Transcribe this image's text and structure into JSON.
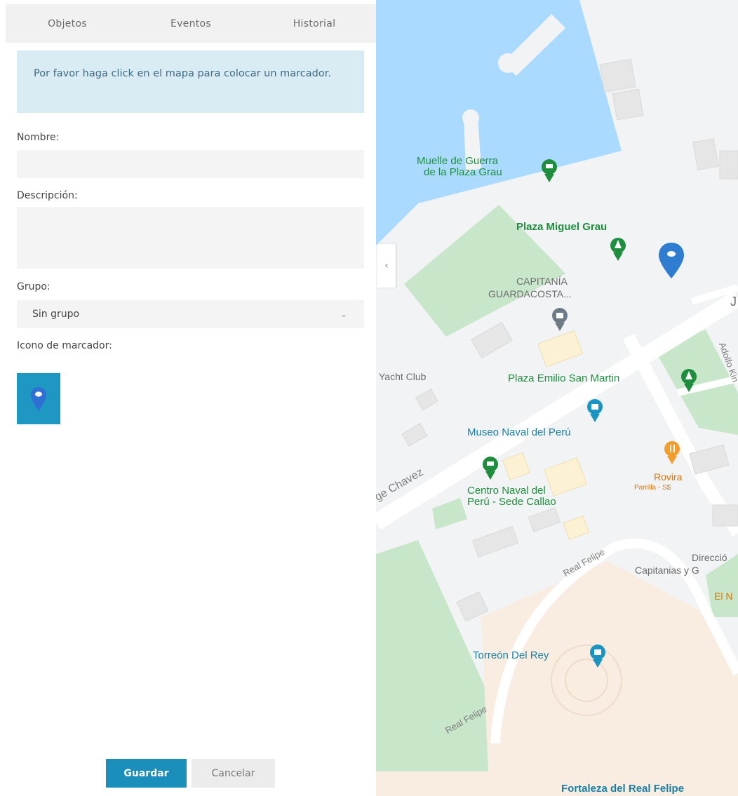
{
  "tabs": [
    {
      "label": "Objetos"
    },
    {
      "label": "Eventos"
    },
    {
      "label": "Historial"
    }
  ],
  "info_message": "Por favor haga click en el mapa para colocar un marcador.",
  "form": {
    "name_label": "Nombre:",
    "name_value": "",
    "description_label": "Descripción:",
    "description_value": "",
    "group_label": "Grupo:",
    "group_value": "Sin grupo",
    "icon_label": "Icono de marcador:",
    "icon": "map-pin-icon"
  },
  "buttons": {
    "save": "Guardar",
    "cancel": "Cancelar"
  },
  "map": {
    "collapse_icon": "chevron-left-icon",
    "labels": {
      "muelle_1": "Muelle de Guerra",
      "muelle_2": "de la Plaza Grau",
      "plaza_grau": "Plaza Miguel Grau",
      "capitania_1": "CAPITANÍA",
      "capitania_2": "GUARDACOSTA...",
      "yacht": "Yacht Club",
      "emilio": "Plaza Emilio San Martin",
      "museo": "Museo Naval del Perú",
      "rovira": "Rovira",
      "rovira_sub": "Parrilla - S$",
      "centro_1": "Centro Naval del",
      "centro_2": "Perú - Sede Callao",
      "chavez": "ge Chavez",
      "real_felipe_1": "Real Felipe",
      "real_felipe_2": "Real Felipe",
      "direccion_1": "Direcció",
      "direccion_2": "Capitanias y G",
      "el_n": "El N",
      "adolfo": "Adolfo Kin",
      "j": "J",
      "torreon": "Torreón Del Rey",
      "fortaleza": "Fortaleza del Real Felipe"
    }
  },
  "colors": {
    "primary": "#1b8fbb",
    "info_bg": "#d9ecf3",
    "water": "#aadaff",
    "park": "#c8e6c9",
    "marker": "#2e7dd1"
  }
}
